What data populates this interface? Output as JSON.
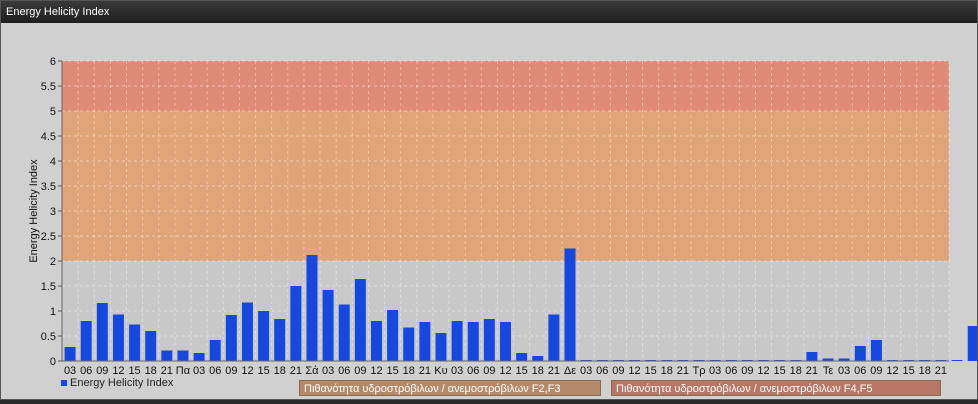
{
  "window": {
    "title": "Energy Helicity Index"
  },
  "colors": {
    "bar": "#1448e0",
    "band_high": "#e08a78",
    "band_mid": "#dfa478",
    "band_low": "#c8c8c8",
    "legend_f2f3": "#b58a6a",
    "legend_f4f5": "#b87666"
  },
  "chart_data": {
    "type": "bar",
    "title": "",
    "xlabel": "",
    "ylabel": "Energy Helicity Index",
    "ylim": [
      0,
      6
    ],
    "yticks": [
      "0",
      "0.5",
      "1",
      "1.5",
      "2",
      "2.5",
      "3",
      "3.5",
      "4",
      "4.5",
      "5",
      "5.5",
      "6"
    ],
    "grid": true,
    "categories": [
      "03",
      "06",
      "09",
      "12",
      "15",
      "18",
      "21",
      "Πα",
      "03",
      "06",
      "09",
      "12",
      "15",
      "18",
      "21",
      "Σά",
      "03",
      "06",
      "09",
      "12",
      "15",
      "18",
      "21",
      "Κυ",
      "03",
      "06",
      "09",
      "12",
      "15",
      "18",
      "21",
      "Δε",
      "03",
      "06",
      "09",
      "12",
      "15",
      "18",
      "21",
      "Τρ",
      "03",
      "06",
      "09",
      "12",
      "15",
      "18",
      "21",
      "Τε",
      "03",
      "06",
      "09",
      "12",
      "15",
      "18",
      "21"
    ],
    "series": [
      {
        "name": "Energy Helicity Index",
        "values": [
          0.28,
          0.8,
          1.16,
          0.93,
          0.73,
          0.6,
          0.21,
          0.21,
          0.16,
          0.42,
          0.92,
          1.17,
          1.0,
          0.84,
          1.5,
          2.12,
          1.42,
          1.13,
          1.64,
          0.8,
          1.02,
          0.67,
          0.78,
          0.56,
          0.8,
          0.78,
          0.84,
          0.78,
          0.16,
          0.1,
          0.93,
          2.25,
          0.02,
          0.02,
          0.02,
          0.02,
          0.02,
          0.02,
          0.02,
          0.02,
          0.02,
          0.02,
          0.02,
          0.02,
          0.02,
          0.02,
          0.18,
          0.05,
          0.05,
          0.3,
          0.42,
          0.02,
          0.02,
          0.02,
          0.02,
          0.02,
          0.7
        ]
      }
    ],
    "bands": [
      {
        "from": 2,
        "to": 5,
        "label": "Πιθανότητα υδροστρόβιλων / ανεμοστρόβιλων F2,F3"
      },
      {
        "from": 5,
        "to": 6,
        "label": "Πιθανότητα υδροστρόβιλων / ανεμοστρόβιλων F4,F5"
      }
    ],
    "legend": {
      "placement": "bottom-left",
      "series_label": "Energy Helicity Index"
    }
  }
}
